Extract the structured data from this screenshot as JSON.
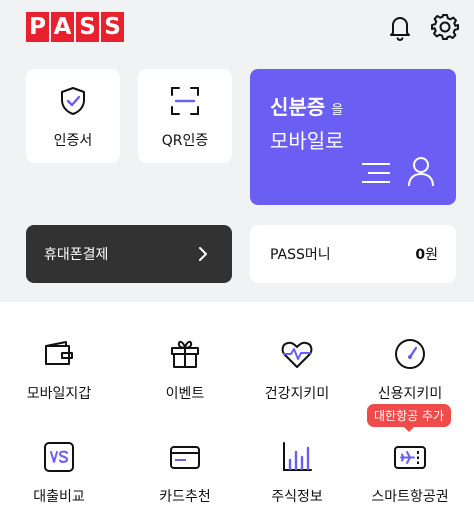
{
  "header": {
    "logo_letters": [
      "P",
      "A",
      "S",
      "S"
    ]
  },
  "cards": {
    "cert_label": "인증서",
    "qr_label": "QR인증",
    "id_title": "신분증",
    "id_suffix": "을",
    "id_subtitle": "모바일로",
    "pay_label": "휴대폰결제",
    "money_label": "PASS머니",
    "money_amount": "0",
    "money_unit": "원"
  },
  "menu": {
    "items": [
      {
        "label": "모바일지갑",
        "icon": "wallet-icon"
      },
      {
        "label": "이벤트",
        "icon": "gift-icon"
      },
      {
        "label": "건강지키미",
        "icon": "heart-pulse-icon"
      },
      {
        "label": "신용지키미",
        "icon": "gauge-icon"
      },
      {
        "label": "대출비교",
        "icon": "vs-icon"
      },
      {
        "label": "카드추천",
        "icon": "card-icon"
      },
      {
        "label": "주식정보",
        "icon": "bar-chart-icon"
      },
      {
        "label": "스마트항공권",
        "icon": "airplane-ticket-icon"
      }
    ],
    "badge": "대한항공 추가"
  },
  "colors": {
    "brand_red": "#e8212e",
    "accent_purple": "#6a5ff2",
    "dark_card": "#323232",
    "badge_red": "#f04b4b",
    "top_bg": "#f1f2f4"
  }
}
